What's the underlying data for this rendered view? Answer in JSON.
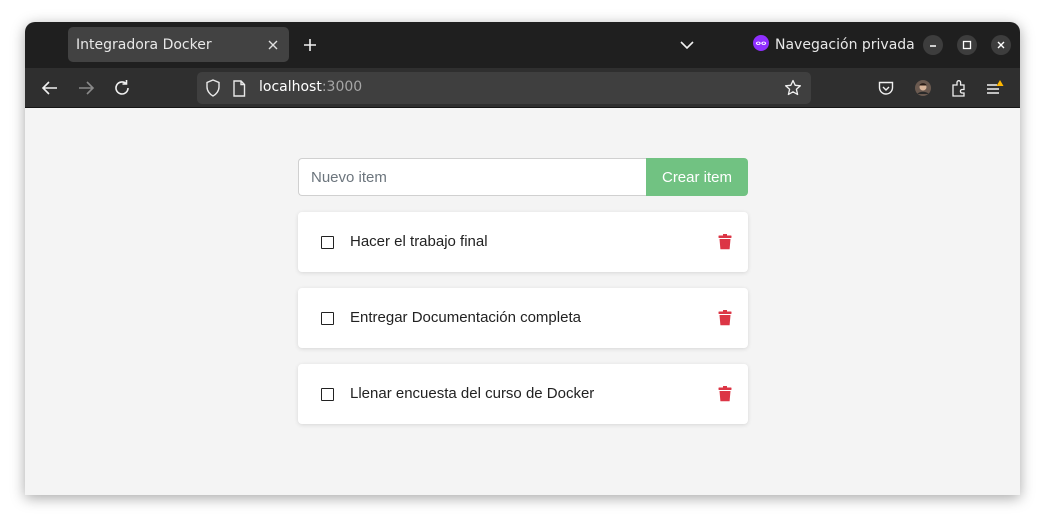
{
  "browser": {
    "tab": {
      "title": "Integradora Docker"
    },
    "private_label": "Navegación privada",
    "url_host": "localhost",
    "url_port": ":3000",
    "private_color": "#8f2fff"
  },
  "app": {
    "input": {
      "placeholder": "Nuevo item",
      "value": ""
    },
    "create_label": "Crear item",
    "accent": "#71c282",
    "delete_color": "#dc3545",
    "items": [
      {
        "text": "Hacer el trabajo final",
        "checked": false
      },
      {
        "text": "Entregar Documentación completa",
        "checked": false
      },
      {
        "text": "Llenar encuesta del curso de Docker",
        "checked": false
      }
    ]
  }
}
